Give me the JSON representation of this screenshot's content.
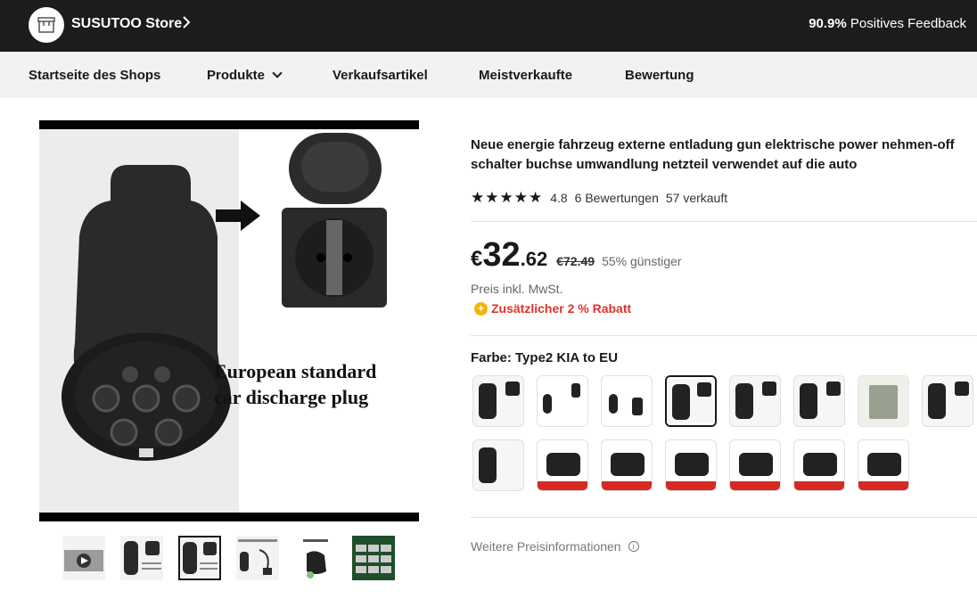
{
  "store": {
    "name": "SUSUTOO Store",
    "feedback_percent": "90.9%",
    "feedback_label": "Positives Feedback"
  },
  "nav": {
    "items": [
      "Startseite des Shops",
      "Produkte",
      "Verkaufsartikel",
      "Meistverkaufte",
      "Bewertung"
    ]
  },
  "gallery": {
    "caption_line1": "European standard",
    "caption_line2": "car discharge plug",
    "thumbnail_count": 6,
    "selected_thumbnail": 3
  },
  "product": {
    "title": "Neue energie fahrzeug externe entladung gun elektrische power nehmen-off schalter buchse umwandlung netzteil verwendet auf die auto",
    "rating": "4.8",
    "stars": "★★★★★",
    "reviews": "6 Bewertungen",
    "sold": "57 verkauft"
  },
  "price": {
    "currency": "€",
    "integer": "32",
    "decimal": ".62",
    "old": "€72.49",
    "discount": "55% günstiger",
    "tax_note": "Preis inkl. MwSt.",
    "coupon": "Zusätzlicher 2 % Rabatt",
    "coupon_icon": "+"
  },
  "variant": {
    "label": "Farbe: Type2 KIA to EU",
    "swatch_count": 14,
    "selected_index": 4
  },
  "more_info": {
    "label": "Weitere Preisinformationen",
    "icon": "i"
  },
  "colors": {
    "topbar_bg": "#1c1c1c",
    "navbar_bg": "#f2f2f2",
    "accent_red": "#e0332a",
    "coupon_yellow": "#f5b400"
  }
}
